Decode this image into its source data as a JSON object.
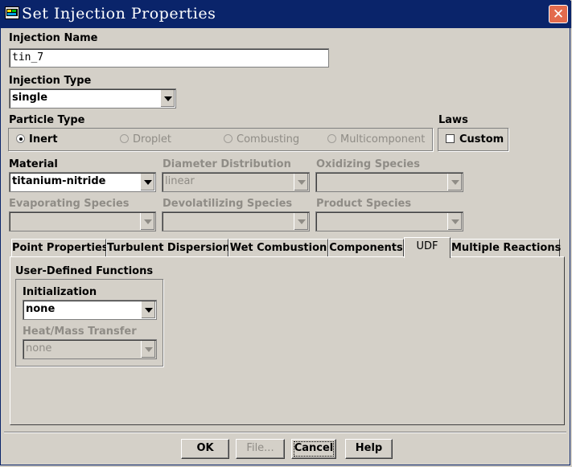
{
  "window": {
    "title": "Set Injection Properties",
    "close_glyph": "✕"
  },
  "injection_name": {
    "label": "Injection Name",
    "value": "tin_7"
  },
  "injection_type": {
    "label": "Injection Type",
    "value": "single"
  },
  "particle_type": {
    "label": "Particle Type",
    "options": [
      "Inert",
      "Droplet",
      "Combusting",
      "Multicomponent"
    ],
    "selected": "Inert"
  },
  "laws": {
    "label": "Laws",
    "custom_label": "Custom",
    "custom_checked": false
  },
  "material": {
    "label": "Material",
    "value": "titanium-nitride"
  },
  "diameter_distribution": {
    "label": "Diameter Distribution",
    "value": "linear"
  },
  "oxidizing_species": {
    "label": "Oxidizing Species",
    "value": ""
  },
  "evaporating_species": {
    "label": "Evaporating Species",
    "value": ""
  },
  "devolatilizing_species": {
    "label": "Devolatilizing Species",
    "value": ""
  },
  "product_species": {
    "label": "Product Species",
    "value": ""
  },
  "tabs": [
    "Point Properties",
    "Turbulent Dispersion",
    "Wet Combustion",
    "Components",
    "UDF",
    "Multiple Reactions"
  ],
  "active_tab": "UDF",
  "udf": {
    "group_label": "User-Defined Functions",
    "initialization_label": "Initialization",
    "initialization_value": "none",
    "heat_mass_label": "Heat/Mass Transfer",
    "heat_mass_value": "none"
  },
  "buttons": {
    "ok": "OK",
    "file": "File...",
    "cancel": "Cancel",
    "help": "Help"
  },
  "colors": {
    "titlebar": "#0a246a",
    "face": "#d4d0c8",
    "close": "#e36b4d",
    "disabled_text": "#8f8c86"
  }
}
